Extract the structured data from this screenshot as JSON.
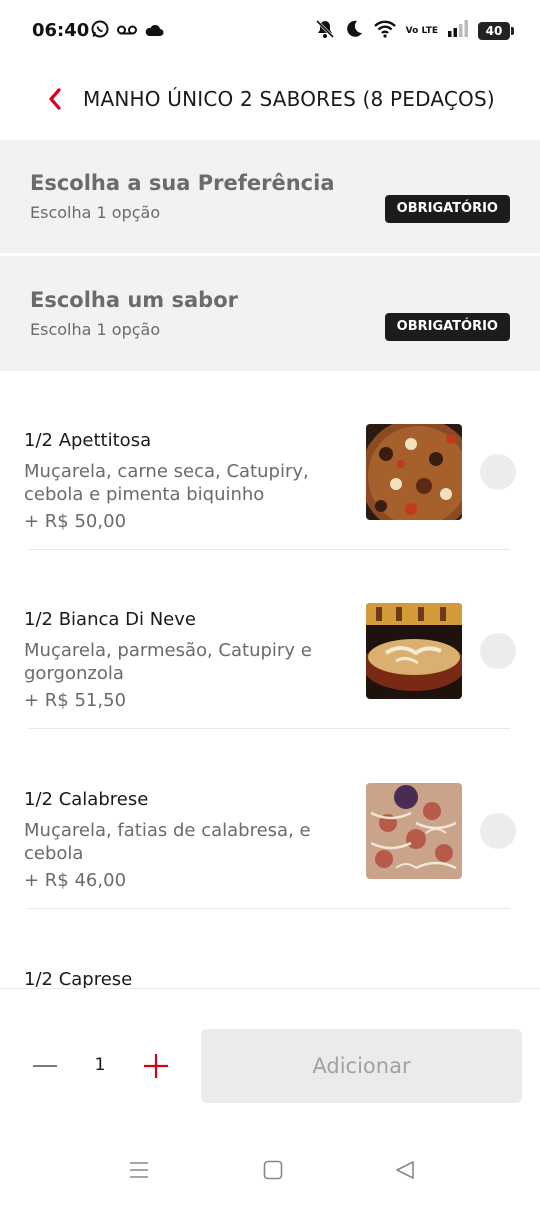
{
  "status_bar": {
    "time": "06:40",
    "battery": "40",
    "network": "Vo LTE",
    "left_icons": [
      "whatsapp-icon",
      "voicemail-icon",
      "cloud-icon"
    ],
    "right_icons": [
      "bell-off-icon",
      "moon-icon",
      "wifi-icon",
      "volte-icon",
      "signal-icon",
      "battery-icon"
    ]
  },
  "header": {
    "title": "MANHO ÚNICO 2 SABORES (8 PEDAÇOS)",
    "back_icon": "chevron-left-icon"
  },
  "sections": [
    {
      "title": "Escolha a sua Preferência",
      "subtitle": "Escolha 1 opção",
      "badge": "OBRIGATÓRIO"
    },
    {
      "title": "Escolha um sabor",
      "subtitle": "Escolha 1 opção",
      "badge": "OBRIGATÓRIO"
    }
  ],
  "items": [
    {
      "name": "1/2 Apettitosa",
      "description": "Muçarela, carne seca, Catupiry, cebola e pimenta biquinho",
      "price": "+ R$ 50,00",
      "selected": false
    },
    {
      "name": "1/2 Bianca Di Neve",
      "description": "Muçarela, parmesão, Catupiry e gorgonzola",
      "price": "+ R$ 51,50",
      "selected": false
    },
    {
      "name": "1/2 Calabrese",
      "description": "Muçarela, fatias de calabresa, e cebola",
      "price": "+ R$ 46,00",
      "selected": false
    },
    {
      "name": "1/2 Caprese"
    }
  ],
  "bottom_bar": {
    "quantity": "1",
    "add_label": "Adicionar",
    "minus_icon": "minus-icon",
    "plus_icon": "plus-icon"
  },
  "nav_bar": {
    "icons": [
      "recents-icon",
      "home-icon",
      "back-icon"
    ]
  },
  "colors": {
    "accent": "#d6001c",
    "badge_bg": "#1c1c1c",
    "section_bg": "#f2f2f2",
    "muted_text": "#6b6b6b",
    "disabled_button": "#ebebeb"
  }
}
